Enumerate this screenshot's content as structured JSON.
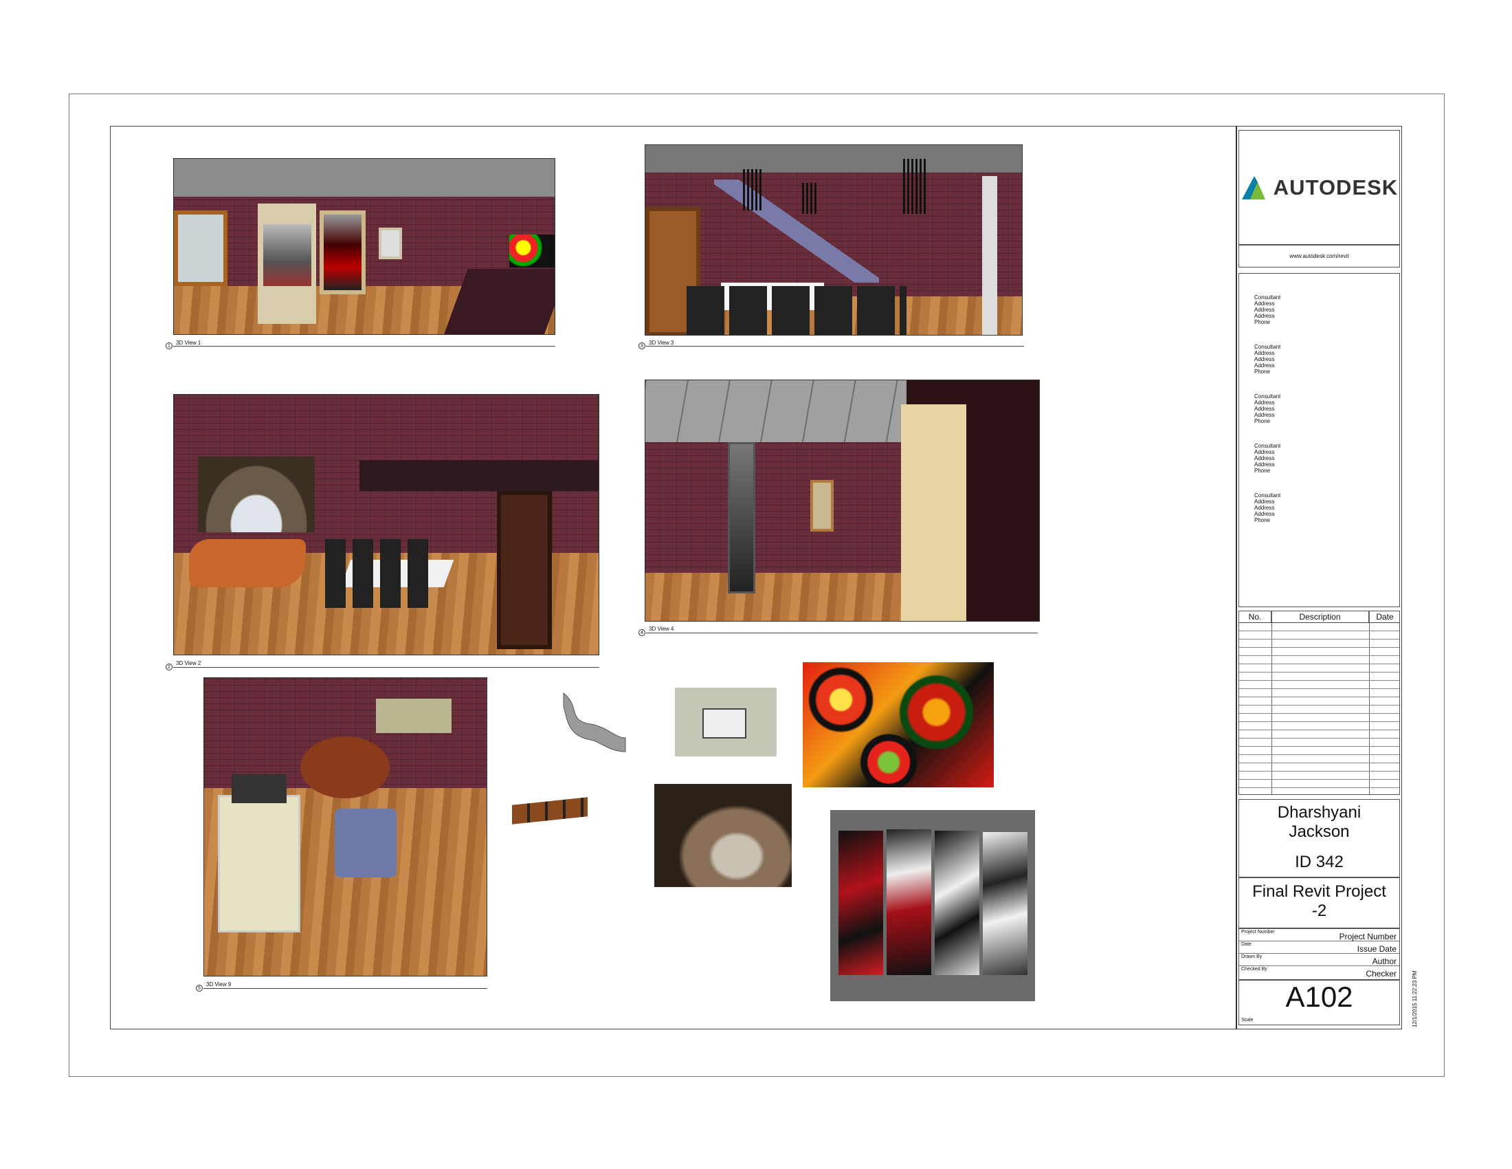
{
  "brand": {
    "name": "AUTODESK",
    "url": "www.autodesk.com/revit"
  },
  "consultants": [
    {
      "title": "Consultant",
      "lines": [
        "Address",
        "Address",
        "Address",
        "Phone"
      ]
    },
    {
      "title": "Consultant",
      "lines": [
        "Address",
        "Address",
        "Address",
        "Phone"
      ]
    },
    {
      "title": "Consultant",
      "lines": [
        "Address",
        "Address",
        "Address",
        "Phone"
      ]
    },
    {
      "title": "Consultant",
      "lines": [
        "Address",
        "Address",
        "Address",
        "Phone"
      ]
    },
    {
      "title": "Consultant",
      "lines": [
        "Address",
        "Address",
        "Address",
        "Phone"
      ]
    }
  ],
  "revisions": {
    "headers": [
      "No.",
      "Description",
      "Date"
    ],
    "rows": []
  },
  "student": {
    "line1": "Dharshyani",
    "line2": "Jackson",
    "id": "ID 342"
  },
  "project": {
    "line1": "Final Revit Project",
    "line2": "-2"
  },
  "meta": [
    {
      "label": "Project Number",
      "value": "Project Number"
    },
    {
      "label": "Date",
      "value": "Issue Date"
    },
    {
      "label": "Drawn By",
      "value": "Author"
    },
    {
      "label": "Checked By",
      "value": "Checker"
    }
  ],
  "sheet": {
    "number": "A102",
    "scale_label": "Scale"
  },
  "timestamp": "12/1/2015 11:22:23 PM",
  "views": [
    {
      "num": "1",
      "label": "3D View 1"
    },
    {
      "num": "3",
      "label": "3D View 3"
    },
    {
      "num": "2",
      "label": "3D View 2"
    },
    {
      "num": "4",
      "label": "3D View 4"
    },
    {
      "num": "5",
      "label": "3D View 9"
    }
  ]
}
